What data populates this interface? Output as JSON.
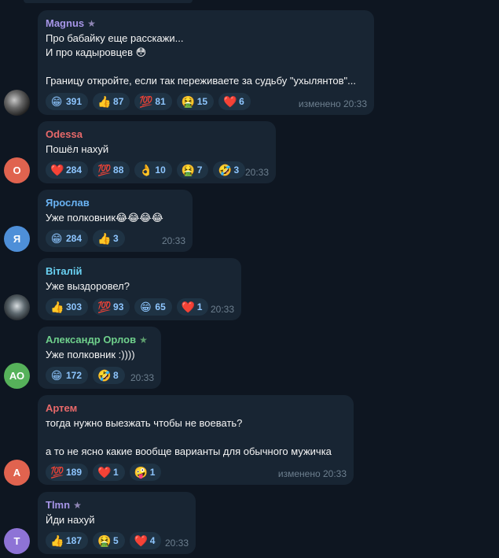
{
  "colors": {
    "bg": "#0e1621",
    "bubble": "#182533",
    "reaction": "#1f3344",
    "reaction_text": "#8ec6ff",
    "time": "#6d7f8f"
  },
  "messages": [
    {
      "author": "Magnus",
      "author_color": "#a695e7",
      "star": "★",
      "star_color": "#8f86b5",
      "avatar_type": "photo",
      "lines": [
        "Про бабайку еще расскажи...",
        "И про кадыровцев 😳",
        "",
        "Границу откройте, если так переживаете за судьбу \"ухылянтов\"..."
      ],
      "reactions": [
        {
          "emoji": "😁",
          "count": "391"
        },
        {
          "emoji": "👍",
          "count": "87"
        },
        {
          "emoji": "💯",
          "count": "81"
        },
        {
          "emoji": "🤮",
          "count": "15"
        },
        {
          "emoji": "❤️",
          "count": "6"
        }
      ],
      "time": "изменено 20:33"
    },
    {
      "author": "Odessa",
      "author_color": "#e8696a",
      "star": "",
      "avatar_type": "letter",
      "avatar_letter": "O",
      "avatar_color": "#e0634f",
      "lines": [
        "Пошёл нахуй"
      ],
      "reactions": [
        {
          "emoji": "❤️",
          "count": "284"
        },
        {
          "emoji": "💯",
          "count": "88"
        },
        {
          "emoji": "👌",
          "count": "10"
        },
        {
          "emoji": "🤮",
          "count": "7"
        },
        {
          "emoji": "🤣",
          "count": "3"
        }
      ],
      "time": "20:33"
    },
    {
      "author": "Ярослав",
      "author_color": "#6ab3f3",
      "star": "",
      "avatar_type": "letter",
      "avatar_letter": "Я",
      "avatar_color": "#4e8fd8",
      "lines": [
        "Уже полковник😂😂😂😂"
      ],
      "reactions": [
        {
          "emoji": "😁",
          "count": "284"
        },
        {
          "emoji": "👍",
          "count": "3"
        }
      ],
      "time": "20:33"
    },
    {
      "author": "Віталій",
      "author_color": "#6ad2f3",
      "star": "",
      "avatar_type": "photo",
      "lines": [
        "Уже выздоровел?"
      ],
      "reactions": [
        {
          "emoji": "👍",
          "count": "303"
        },
        {
          "emoji": "💯",
          "count": "93"
        },
        {
          "emoji": "😁",
          "count": "65"
        },
        {
          "emoji": "❤️",
          "count": "1"
        }
      ],
      "time": "20:33"
    },
    {
      "author": "Александр Орлов",
      "author_color": "#6fd08c",
      "star": "★",
      "star_color": "#5e9e6e",
      "avatar_type": "letter",
      "avatar_letter": "АО",
      "avatar_color": "#56b15a",
      "lines": [
        "Уже полковник :))))"
      ],
      "reactions": [
        {
          "emoji": "😁",
          "count": "172"
        },
        {
          "emoji": "🤣",
          "count": "8"
        }
      ],
      "time": "20:33"
    },
    {
      "author": "Артем",
      "author_color": "#e8696a",
      "star": "",
      "avatar_type": "letter",
      "avatar_letter": "А",
      "avatar_color": "#e0634f",
      "lines": [
        "тогда нужно выезжать чтобы не воевать?",
        "",
        "а то не ясно какие вообще варианты для обычного мужичка"
      ],
      "reactions": [
        {
          "emoji": "💯",
          "count": "189"
        },
        {
          "emoji": "❤️",
          "count": "1"
        },
        {
          "emoji": "🤪",
          "count": "1"
        }
      ],
      "time": "изменено 20:33"
    },
    {
      "author": "Tlmn",
      "author_color": "#a695e7",
      "star": "★",
      "star_color": "#8f86b5",
      "avatar_type": "letter",
      "avatar_letter": "T",
      "avatar_color": "#8e73d6",
      "lines": [
        "Йди нахуй"
      ],
      "reactions": [
        {
          "emoji": "👍",
          "count": "187"
        },
        {
          "emoji": "🤮",
          "count": "5"
        },
        {
          "emoji": "❤️",
          "count": "4"
        }
      ],
      "time": "20:33"
    }
  ]
}
